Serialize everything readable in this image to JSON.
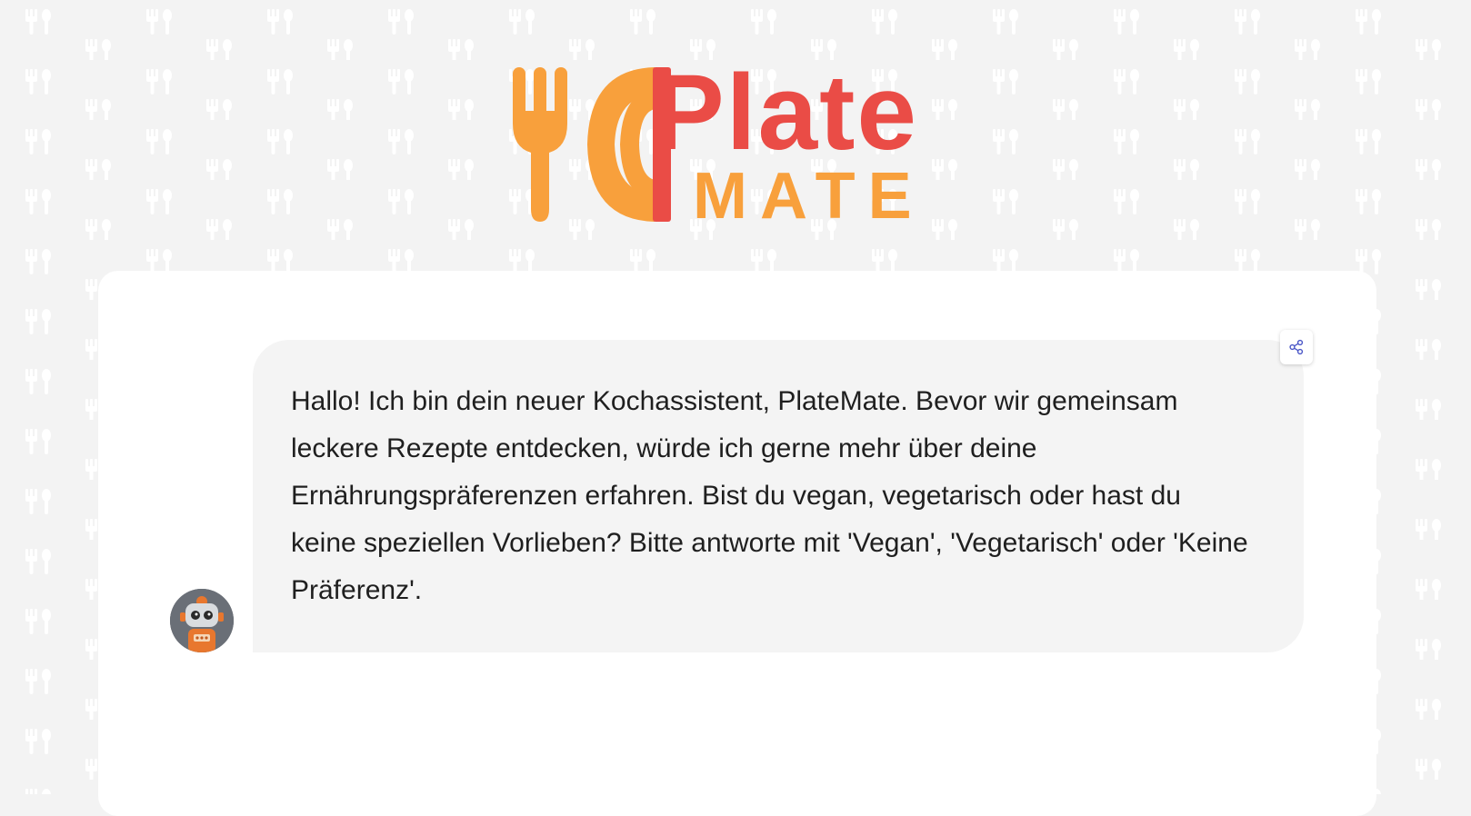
{
  "brand": {
    "name_top": "Plate",
    "name_bottom": "MATE",
    "color_primary": "#ea4c46",
    "color_secondary": "#f8a03c",
    "logo_icon": "fork-and-plate-icon"
  },
  "chat": {
    "messages": [
      {
        "sender": "assistant",
        "avatar": "robot-avatar",
        "text": "Hallo! Ich bin dein neuer Kochassistent, PlateMate. Bevor wir gemeinsam leckere Rezepte entdecken, würde ich gerne mehr über deine Ernährungspräferenzen erfahren. Bist du vegan, vegetarisch oder hast du keine speziellen Vorlieben? Bitte antworte mit 'Vegan', 'Vegetarisch' oder 'Keine Präferenz'."
      }
    ],
    "actions": {
      "share_icon": "share-icon"
    }
  },
  "background": {
    "color": "#f3f3f3",
    "pattern_icon": "cutlery-pattern-icon",
    "card_color": "#ffffff",
    "bubble_color": "#f4f4f4"
  }
}
